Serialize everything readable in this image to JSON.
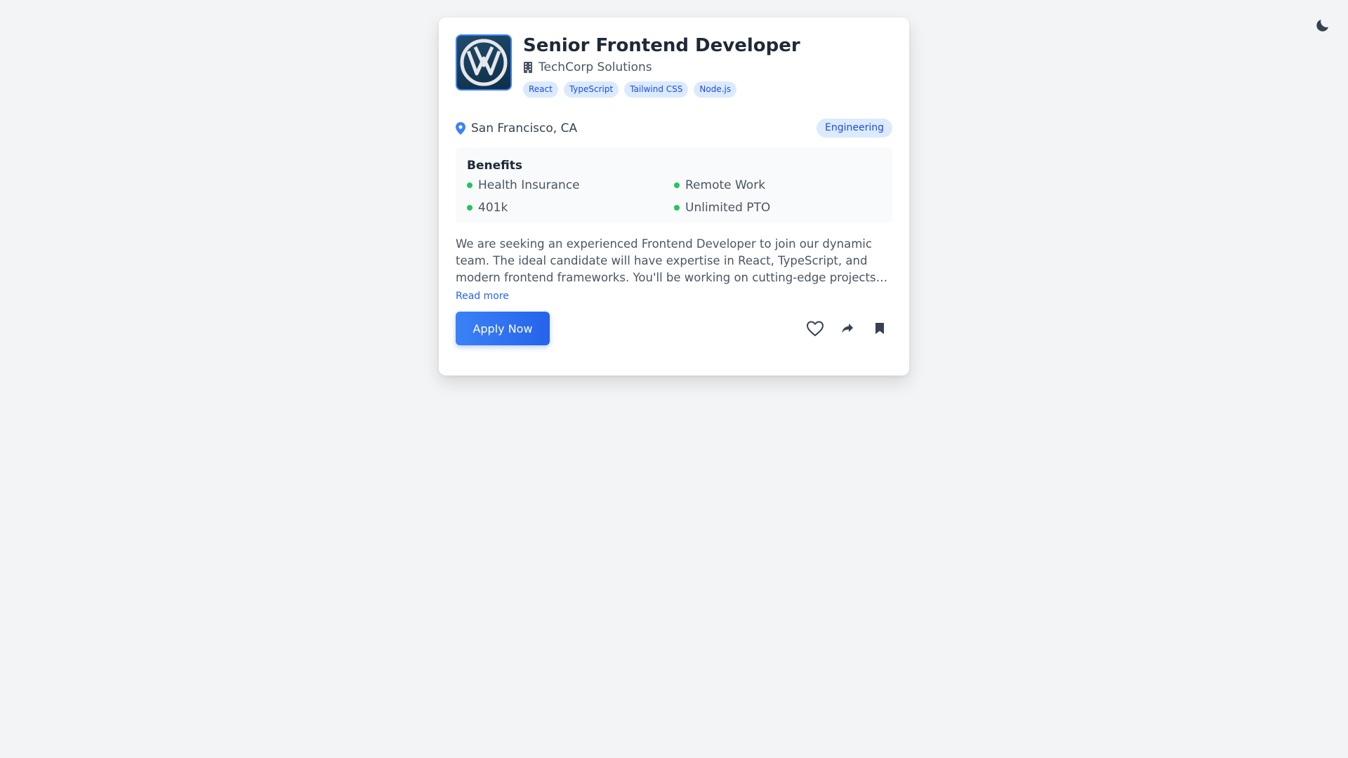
{
  "job": {
    "title": "Senior Frontend Developer",
    "company": "TechCorp Solutions",
    "tags": [
      "React",
      "TypeScript",
      "Tailwind CSS",
      "Node.js"
    ],
    "location": "San Francisco, CA",
    "department": "Engineering"
  },
  "benefits": {
    "title": "Benefits",
    "items": [
      "Health Insurance",
      "Remote Work",
      "401k",
      "Unlimited PTO"
    ]
  },
  "description": "We are seeking an experienced Frontend Developer to join our dynamic team. The ideal candidate will have expertise in React, TypeScript, and modern frontend frameworks. You'll be working on cutting-edge projects with a talented team of engineers and designers.",
  "read_more_label": "Read more",
  "actions": {
    "apply_label": "Apply Now"
  },
  "icons": {
    "theme_toggle": "moon-icon",
    "company": "building-icon",
    "location": "map-pin-icon",
    "like": "heart-icon",
    "share": "share-icon",
    "save": "bookmark-icon"
  },
  "colors": {
    "accent": "#2563eb",
    "tag_bg": "#dbeafe",
    "benefit_dot": "#22c55e"
  }
}
